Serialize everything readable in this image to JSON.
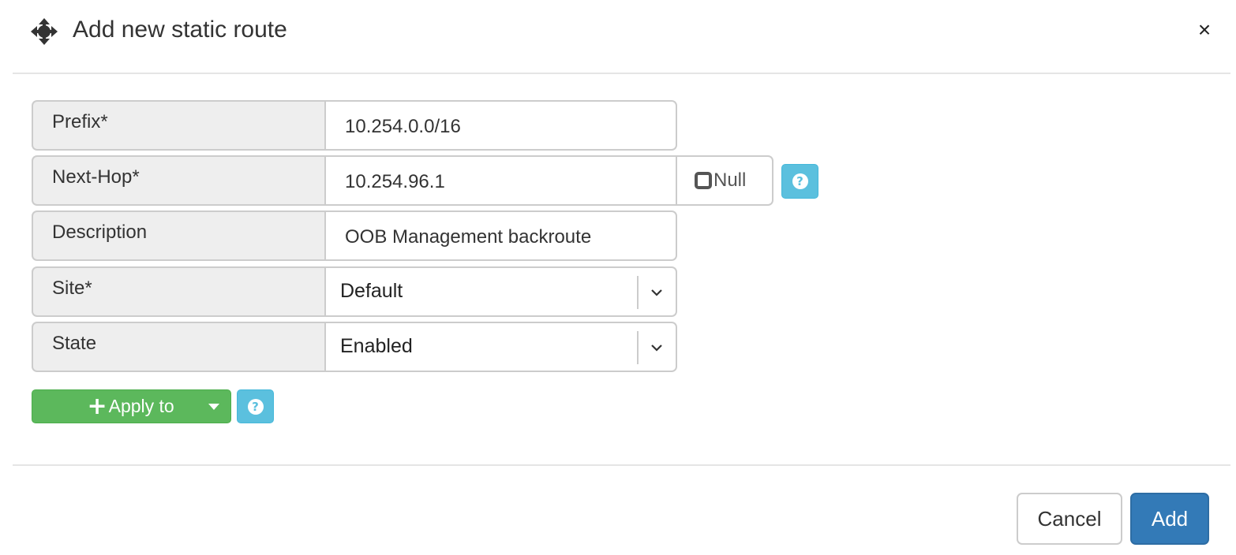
{
  "header": {
    "title": "Add new static route",
    "move_icon": "move-arrows-icon",
    "close_label": "×"
  },
  "form": {
    "prefix": {
      "label": "Prefix*",
      "value": "10.254.0.0/16"
    },
    "next_hop": {
      "label": "Next-Hop*",
      "value": "10.254.96.1",
      "null_label": "Null",
      "null_checked": false
    },
    "description": {
      "label": "Description",
      "value": "OOB Management backroute"
    },
    "site": {
      "label": "Site*",
      "selected": "Default"
    },
    "state": {
      "label": "State",
      "selected": "Enabled"
    },
    "help_icon": "question-circle-icon"
  },
  "apply": {
    "plus": "+",
    "label": "Apply to"
  },
  "footer": {
    "cancel_label": "Cancel",
    "add_label": "Add"
  },
  "colors": {
    "info": "#5bc0de",
    "success": "#5cb85c",
    "primary": "#337ab7",
    "addon_bg": "#eeeeee",
    "border": "#cccccc"
  }
}
